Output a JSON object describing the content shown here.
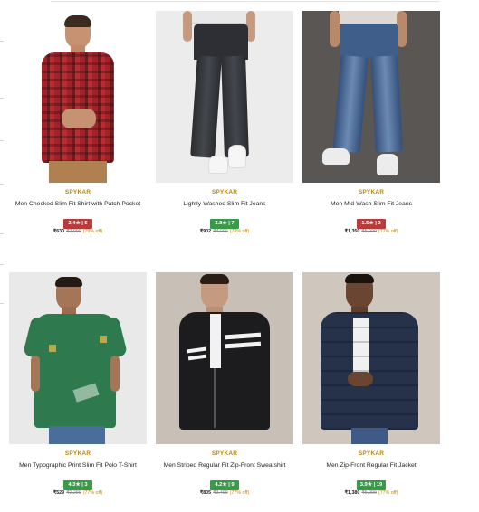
{
  "colors": {
    "brand": "#b8860b",
    "rating_red": "#b93a3a",
    "rating_green": "#3a9a4a",
    "discount": "#b8860b"
  },
  "products": [
    {
      "brand": "SPYKAR",
      "name": "Men Checked Slim Fit Shirt with Patch Pocket",
      "rating": "2.4★ | 5",
      "rating_color": "red",
      "price": "₹630",
      "mrp": "₹2,999",
      "off": "(79% off)"
    },
    {
      "brand": "SPYKAR",
      "name": "Lightly-Washed Slim Fit Jeans",
      "rating": "3.8★ | 7",
      "rating_color": "green",
      "price": "₹902",
      "mrp": "₹4,099",
      "off": "(78% off)"
    },
    {
      "brand": "SPYKAR",
      "name": "Men Mid-Wash Slim Fit Jeans",
      "rating": "1.5★ | 2",
      "rating_color": "red",
      "price": "₹1,350",
      "mrp": "₹5,999",
      "off": "(77% off)"
    },
    {
      "brand": "SPYKAR",
      "name": "Men Typographic Print Slim Fit Polo T-Shirt",
      "rating": "4.3★ | 3",
      "rating_color": "green",
      "price": "₹529",
      "mrp": "₹2,299",
      "off": "(77% off)"
    },
    {
      "brand": "SPYKAR",
      "name": "Men Striped Regular Fit Zip-Front Sweatshirt",
      "rating": "4.2★ | 9",
      "rating_color": "green",
      "price": "₹805",
      "mrp": "₹3,499",
      "off": "(77% off)"
    },
    {
      "brand": "SPYKAR",
      "name": "Men Zip-Front Regular Fit Jacket",
      "rating": "3.9★ | 19",
      "rating_color": "green",
      "price": "₹1,380",
      "mrp": "₹5,999",
      "off": "(77% off)"
    }
  ]
}
